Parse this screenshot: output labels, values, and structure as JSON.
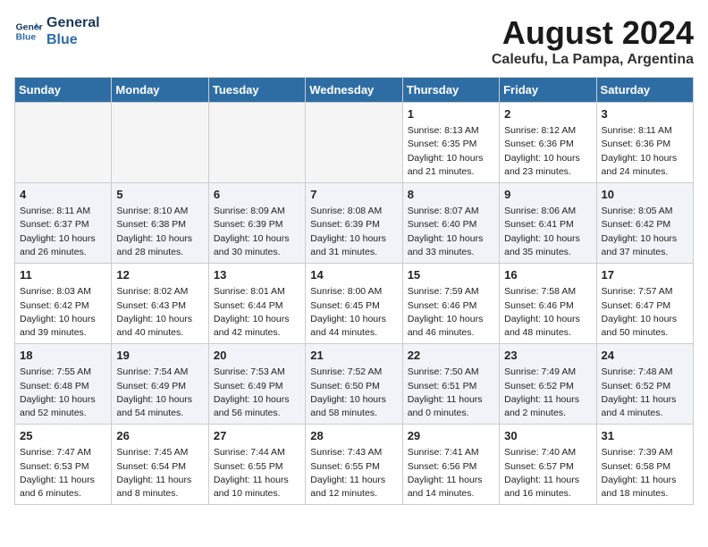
{
  "header": {
    "logo_line1": "General",
    "logo_line2": "Blue",
    "main_title": "August 2024",
    "subtitle": "Caleufu, La Pampa, Argentina"
  },
  "weekdays": [
    "Sunday",
    "Monday",
    "Tuesday",
    "Wednesday",
    "Thursday",
    "Friday",
    "Saturday"
  ],
  "weeks": [
    [
      {
        "day": "",
        "info": ""
      },
      {
        "day": "",
        "info": ""
      },
      {
        "day": "",
        "info": ""
      },
      {
        "day": "",
        "info": ""
      },
      {
        "day": "1",
        "info": "Sunrise: 8:13 AM\nSunset: 6:35 PM\nDaylight: 10 hours\nand 21 minutes."
      },
      {
        "day": "2",
        "info": "Sunrise: 8:12 AM\nSunset: 6:36 PM\nDaylight: 10 hours\nand 23 minutes."
      },
      {
        "day": "3",
        "info": "Sunrise: 8:11 AM\nSunset: 6:36 PM\nDaylight: 10 hours\nand 24 minutes."
      }
    ],
    [
      {
        "day": "4",
        "info": "Sunrise: 8:11 AM\nSunset: 6:37 PM\nDaylight: 10 hours\nand 26 minutes."
      },
      {
        "day": "5",
        "info": "Sunrise: 8:10 AM\nSunset: 6:38 PM\nDaylight: 10 hours\nand 28 minutes."
      },
      {
        "day": "6",
        "info": "Sunrise: 8:09 AM\nSunset: 6:39 PM\nDaylight: 10 hours\nand 30 minutes."
      },
      {
        "day": "7",
        "info": "Sunrise: 8:08 AM\nSunset: 6:39 PM\nDaylight: 10 hours\nand 31 minutes."
      },
      {
        "day": "8",
        "info": "Sunrise: 8:07 AM\nSunset: 6:40 PM\nDaylight: 10 hours\nand 33 minutes."
      },
      {
        "day": "9",
        "info": "Sunrise: 8:06 AM\nSunset: 6:41 PM\nDaylight: 10 hours\nand 35 minutes."
      },
      {
        "day": "10",
        "info": "Sunrise: 8:05 AM\nSunset: 6:42 PM\nDaylight: 10 hours\nand 37 minutes."
      }
    ],
    [
      {
        "day": "11",
        "info": "Sunrise: 8:03 AM\nSunset: 6:42 PM\nDaylight: 10 hours\nand 39 minutes."
      },
      {
        "day": "12",
        "info": "Sunrise: 8:02 AM\nSunset: 6:43 PM\nDaylight: 10 hours\nand 40 minutes."
      },
      {
        "day": "13",
        "info": "Sunrise: 8:01 AM\nSunset: 6:44 PM\nDaylight: 10 hours\nand 42 minutes."
      },
      {
        "day": "14",
        "info": "Sunrise: 8:00 AM\nSunset: 6:45 PM\nDaylight: 10 hours\nand 44 minutes."
      },
      {
        "day": "15",
        "info": "Sunrise: 7:59 AM\nSunset: 6:46 PM\nDaylight: 10 hours\nand 46 minutes."
      },
      {
        "day": "16",
        "info": "Sunrise: 7:58 AM\nSunset: 6:46 PM\nDaylight: 10 hours\nand 48 minutes."
      },
      {
        "day": "17",
        "info": "Sunrise: 7:57 AM\nSunset: 6:47 PM\nDaylight: 10 hours\nand 50 minutes."
      }
    ],
    [
      {
        "day": "18",
        "info": "Sunrise: 7:55 AM\nSunset: 6:48 PM\nDaylight: 10 hours\nand 52 minutes."
      },
      {
        "day": "19",
        "info": "Sunrise: 7:54 AM\nSunset: 6:49 PM\nDaylight: 10 hours\nand 54 minutes."
      },
      {
        "day": "20",
        "info": "Sunrise: 7:53 AM\nSunset: 6:49 PM\nDaylight: 10 hours\nand 56 minutes."
      },
      {
        "day": "21",
        "info": "Sunrise: 7:52 AM\nSunset: 6:50 PM\nDaylight: 10 hours\nand 58 minutes."
      },
      {
        "day": "22",
        "info": "Sunrise: 7:50 AM\nSunset: 6:51 PM\nDaylight: 11 hours\nand 0 minutes."
      },
      {
        "day": "23",
        "info": "Sunrise: 7:49 AM\nSunset: 6:52 PM\nDaylight: 11 hours\nand 2 minutes."
      },
      {
        "day": "24",
        "info": "Sunrise: 7:48 AM\nSunset: 6:52 PM\nDaylight: 11 hours\nand 4 minutes."
      }
    ],
    [
      {
        "day": "25",
        "info": "Sunrise: 7:47 AM\nSunset: 6:53 PM\nDaylight: 11 hours\nand 6 minutes."
      },
      {
        "day": "26",
        "info": "Sunrise: 7:45 AM\nSunset: 6:54 PM\nDaylight: 11 hours\nand 8 minutes."
      },
      {
        "day": "27",
        "info": "Sunrise: 7:44 AM\nSunset: 6:55 PM\nDaylight: 11 hours\nand 10 minutes."
      },
      {
        "day": "28",
        "info": "Sunrise: 7:43 AM\nSunset: 6:55 PM\nDaylight: 11 hours\nand 12 minutes."
      },
      {
        "day": "29",
        "info": "Sunrise: 7:41 AM\nSunset: 6:56 PM\nDaylight: 11 hours\nand 14 minutes."
      },
      {
        "day": "30",
        "info": "Sunrise: 7:40 AM\nSunset: 6:57 PM\nDaylight: 11 hours\nand 16 minutes."
      },
      {
        "day": "31",
        "info": "Sunrise: 7:39 AM\nSunset: 6:58 PM\nDaylight: 11 hours\nand 18 minutes."
      }
    ]
  ]
}
